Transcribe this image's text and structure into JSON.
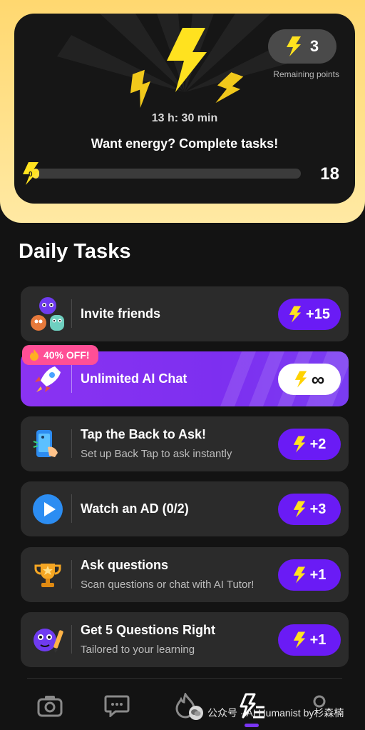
{
  "energy": {
    "remaining_points": "3",
    "remaining_label": "Remaining points",
    "timer": "13 h: 30 min",
    "cta": "Want energy? Complete tasks!",
    "progress_value": "0",
    "progress_max": "18",
    "progress_fraction": 0.03
  },
  "daily_tasks": {
    "title": "Daily Tasks",
    "items": [
      {
        "title": "Invite friends",
        "subtitle": "",
        "reward": "+15"
      },
      {
        "title": "Unlimited AI Chat",
        "subtitle": "",
        "reward": "∞",
        "badge": "40% OFF!"
      },
      {
        "title": "Tap the Back to Ask!",
        "subtitle": "Set up Back Tap to ask instantly",
        "reward": "+2"
      },
      {
        "title": "Watch an AD (0/2)",
        "subtitle": "",
        "reward": "+3"
      },
      {
        "title": "Ask questions",
        "subtitle": "Scan questions or chat with AI Tutor!",
        "reward": "+1"
      },
      {
        "title": "Get 5 Questions Right",
        "subtitle": "Tailored to your learning",
        "reward": "+1"
      }
    ]
  },
  "nav": {
    "items": [
      "camera-icon",
      "chat-icon",
      "flame-icon",
      "energy-tasks-icon",
      "profile-icon"
    ],
    "active": "energy-tasks-icon"
  },
  "watermark": "公众号 · AI Humanist by杉森楠",
  "colors": {
    "accent_purple": "#6a1bf5",
    "energy_yellow": "#ffe23a",
    "header_gold": "#ffd870",
    "promo_pink": "#ff4f96"
  }
}
